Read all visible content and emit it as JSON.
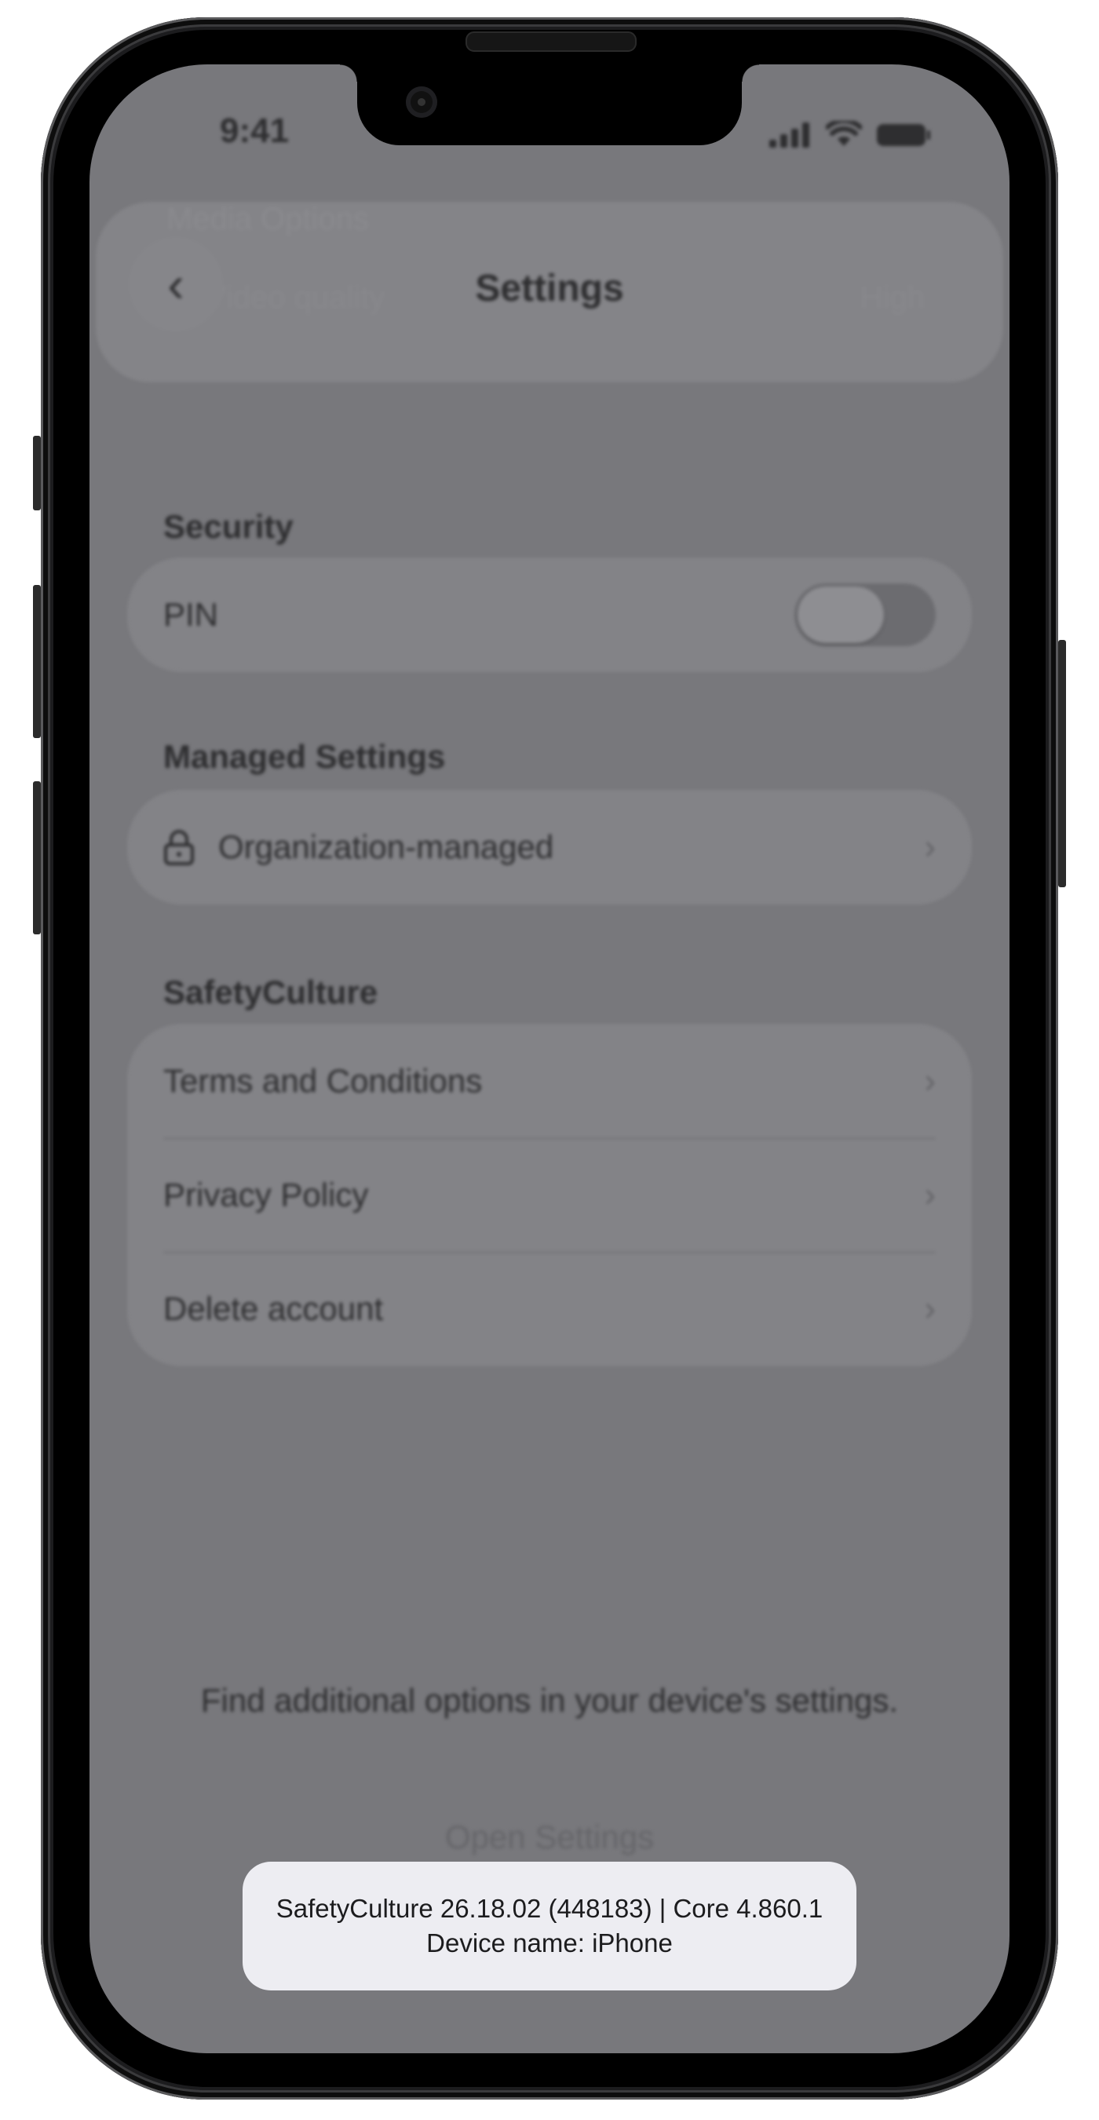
{
  "status_bar": {
    "time": "9:41"
  },
  "header": {
    "title": "Settings",
    "back_icon": "chevron-left-icon",
    "faded_section": "Media Options",
    "faded_row_label": "Video quality",
    "faded_row_value": "High"
  },
  "sections": {
    "security": {
      "title": "Security",
      "pin_label": "PIN",
      "pin_enabled": false
    },
    "managed": {
      "title": "Managed Settings",
      "row_label": "Organization-managed",
      "icon": "lock-icon"
    },
    "safetyculture": {
      "title": "SafetyCulture",
      "items": [
        {
          "label": "Terms and Conditions"
        },
        {
          "label": "Privacy Policy"
        },
        {
          "label": "Delete account"
        }
      ]
    }
  },
  "footer": {
    "hint": "Find additional options in your device's settings.",
    "open_settings": "Open Settings"
  },
  "toast": {
    "version_line": "SafetyCulture 26.18.02 (448183) | Core 4.860.1",
    "device_line": "Device name: iPhone"
  },
  "colors": {
    "overlay": "#78787c",
    "toast_bg": "#ededf2"
  }
}
